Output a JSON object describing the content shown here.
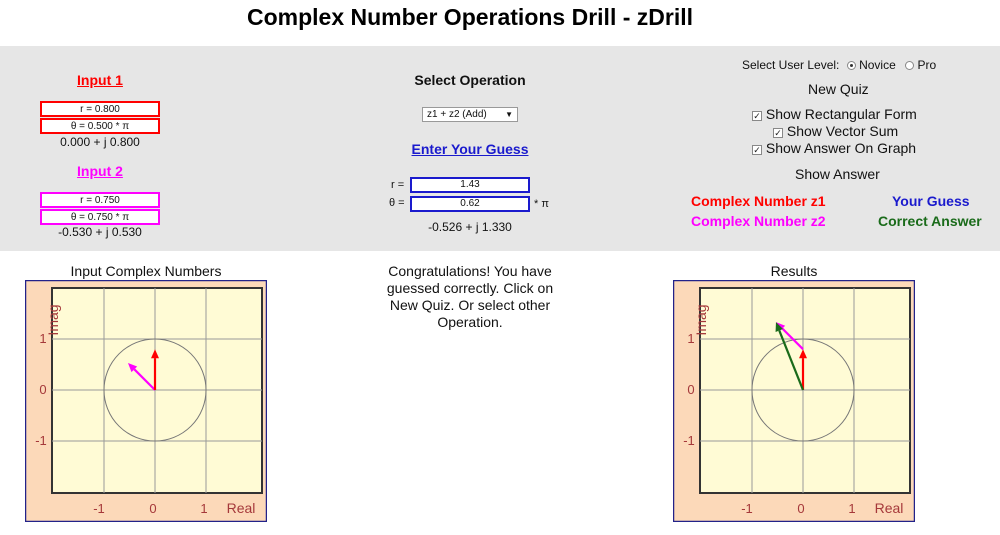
{
  "app": {
    "title": "Complex Number Operations Drill - zDrill"
  },
  "input1": {
    "title": "Input 1",
    "r": "r = 0.800",
    "theta": "θ = 0.500 * π",
    "rect": "0.000 + j 0.800",
    "color": "#ff0000"
  },
  "input2": {
    "title": "Input 2",
    "r": "r = 0.750",
    "theta": "θ = 0.750 * π",
    "rect": "-0.530 + j 0.530",
    "color": "#ff00ff"
  },
  "operation": {
    "title": "Select Operation",
    "selected": "z1 + z2 (Add)"
  },
  "guess": {
    "title": "Enter Your Guess",
    "r_label": "r =",
    "r_value": "1.43",
    "theta_label": "θ =",
    "theta_value": "0.62",
    "theta_unit": "* π",
    "rect": "-0.526 + j 1.330",
    "color": "#1a1acd"
  },
  "settings": {
    "level_label": "Select User Level:",
    "level_novice": "Novice",
    "level_pro": "Pro",
    "level_selected": "Novice",
    "new_quiz": "New Quiz",
    "show_rect": "Show Rectangular Form",
    "show_vector_sum": "Show Vector Sum",
    "show_answer_graph": "Show Answer On Graph",
    "show_answer": "Show Answer"
  },
  "legend": {
    "z1": "Complex Number z1",
    "z2": "Complex Number z2",
    "your_guess": "Your Guess",
    "correct": "Correct Answer",
    "colors": {
      "z1": "#ff0000",
      "z2": "#ff00ff",
      "guess": "#1a1acd",
      "correct": "#1a6b1a"
    }
  },
  "message": "Congratulations! You have guessed correctly. Click on New Quiz. Or select other Operation.",
  "graph_left": {
    "title": "Input Complex Numbers",
    "y_label": "Imag",
    "x_label": "Real",
    "y_ticks": [
      "1",
      "0",
      "-1"
    ],
    "x_ticks": [
      "-1",
      "0",
      "1"
    ]
  },
  "graph_right": {
    "title": "Results",
    "y_label": "Imag",
    "x_label": "Real",
    "y_ticks": [
      "1",
      "0",
      "-1"
    ],
    "x_ticks": [
      "-1",
      "0",
      "1"
    ]
  },
  "vectors": {
    "z1": {
      "re": 0.0,
      "im": 0.8
    },
    "z2": {
      "re": -0.53,
      "im": 0.53
    },
    "sum": {
      "re": -0.53,
      "im": 1.33
    }
  }
}
